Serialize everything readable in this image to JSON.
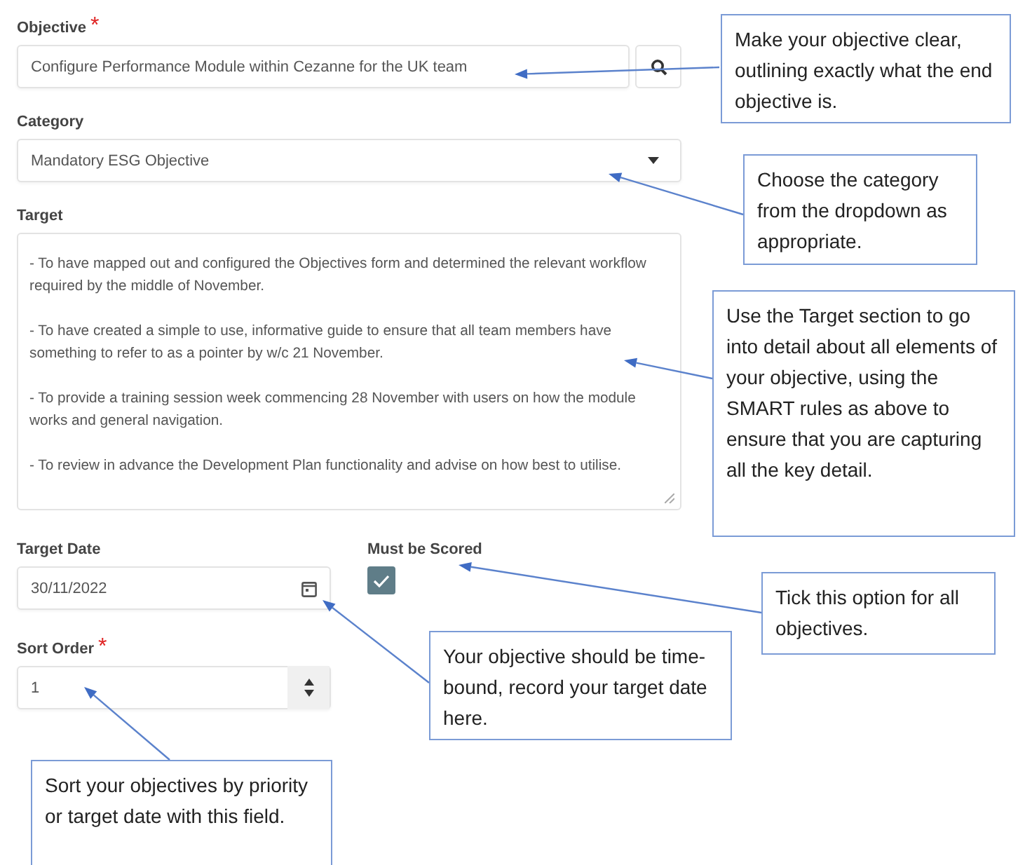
{
  "objective": {
    "label": "Objective",
    "required_mark": "*",
    "value": "Configure Performance Module within Cezanne for the UK team"
  },
  "category": {
    "label": "Category",
    "value": "Mandatory ESG Objective"
  },
  "target": {
    "label": "Target",
    "paragraphs": [
      "- To have mapped out and configured the Objectives form and determined the relevant workflow required by the middle of November.",
      "- To have created a simple to use, informative guide to ensure that all team members have something to refer to as a pointer by w/c 21 November.",
      "- To provide a training session week commencing 28 November with users on how the module works and general navigation.",
      "- To review in advance the Development Plan functionality and advise on how best to utilise."
    ]
  },
  "target_date": {
    "label": "Target Date",
    "value": "30/11/2022"
  },
  "must_be_scored": {
    "label": "Must be Scored",
    "checked": true
  },
  "sort_order": {
    "label": "Sort Order",
    "required_mark": "*",
    "value": "1"
  },
  "callouts": [
    {
      "text": "Make your objective clear, outlining exactly what the end objective is."
    },
    {
      "text": "Choose the category from the dropdown as appropriate."
    },
    {
      "text": "Use the Target section to go into detail about all elements of your objective, using the SMART rules as above to ensure that you are capturing all the key detail."
    },
    {
      "text": "Tick this option for all objectives."
    },
    {
      "text": "Your objective should be time-bound, record your target date here."
    },
    {
      "text": "Sort your objectives by priority or target date with this field."
    }
  ]
}
